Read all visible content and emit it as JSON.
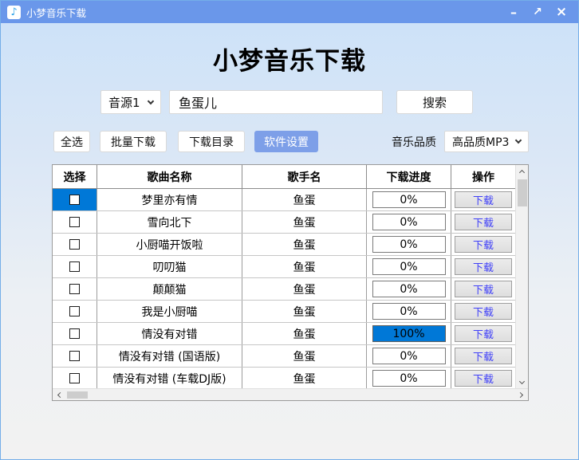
{
  "window": {
    "title": "小梦音乐下载",
    "minimize_glyph": "–",
    "maximize_glyph": "↗",
    "close_glyph": "×",
    "app_icon_glyph": "♪"
  },
  "page": {
    "heading": "小梦音乐下载"
  },
  "search": {
    "source": "音源1",
    "keyword": "鱼蛋儿",
    "button": "搜索"
  },
  "toolbar": {
    "select_all": "全选",
    "batch_download": "批量下载",
    "download_dir": "下载目录",
    "settings": "软件设置",
    "quality_label": "音乐品质",
    "quality": "高品质MP3"
  },
  "table": {
    "headers": [
      "选择",
      "歌曲名称",
      "歌手名",
      "下载进度",
      "操作"
    ],
    "download_button": "下载",
    "rows": [
      {
        "song": "梦里亦有情",
        "artist": "鱼蛋",
        "progress": "0%",
        "selected": true,
        "checked": false
      },
      {
        "song": "雪向北下",
        "artist": "鱼蛋",
        "progress": "0%",
        "selected": false,
        "checked": false
      },
      {
        "song": "小厨喵开饭啦",
        "artist": "鱼蛋",
        "progress": "0%",
        "selected": false,
        "checked": false
      },
      {
        "song": "叨叨猫",
        "artist": "鱼蛋",
        "progress": "0%",
        "selected": false,
        "checked": false
      },
      {
        "song": "颠颠猫",
        "artist": "鱼蛋",
        "progress": "0%",
        "selected": false,
        "checked": false
      },
      {
        "song": "我是小厨喵",
        "artist": "鱼蛋",
        "progress": "0%",
        "selected": false,
        "checked": false
      },
      {
        "song": "情没有对错",
        "artist": "鱼蛋",
        "progress": "100%",
        "selected": false,
        "checked": false
      },
      {
        "song": "情没有对错 (国语版)",
        "artist": "鱼蛋",
        "progress": "0%",
        "selected": false,
        "checked": false
      },
      {
        "song": "情没有对错 (车载DJ版)",
        "artist": "鱼蛋",
        "progress": "0%",
        "selected": false,
        "checked": false
      }
    ]
  },
  "colors": {
    "titlebar": "#6a97ea",
    "accent_blue": "#0078d7",
    "settings_button": "#7d9fe8",
    "download_text": "#4040f8"
  }
}
